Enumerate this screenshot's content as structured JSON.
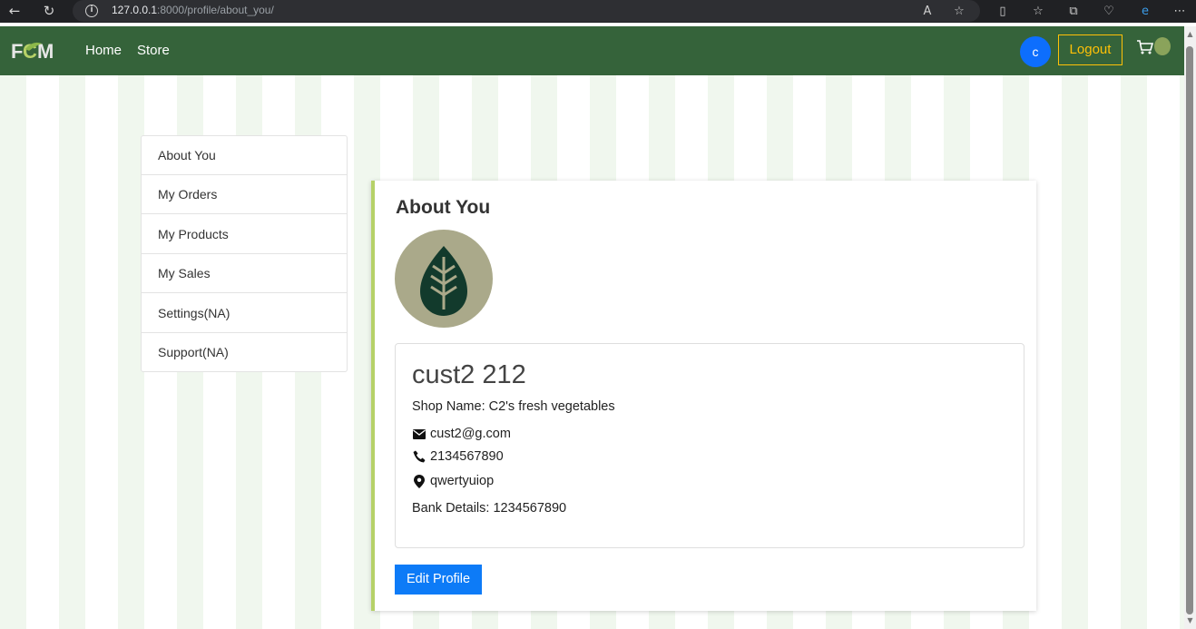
{
  "browser": {
    "url_host": "127.0.0.1",
    "url_path": ":8000/profile/about_you/"
  },
  "navbar": {
    "links": [
      "Home",
      "Store"
    ],
    "avatar_letter": "c",
    "logout_label": "Logout"
  },
  "sidebar": {
    "items": [
      {
        "label": "About You"
      },
      {
        "label": "My Orders"
      },
      {
        "label": "My Products"
      },
      {
        "label": "My Sales"
      },
      {
        "label": "Settings(NA)"
      },
      {
        "label": "Support(NA)"
      }
    ]
  },
  "profile": {
    "heading": "About You",
    "name": "cust2 212",
    "shop_name": "Shop Name: C2's fresh vegetables",
    "email": "cust2@g.com",
    "phone": "2134567890",
    "location": "qwertyuiop",
    "bank": "Bank Details: 1234567890",
    "edit_label": "Edit Profile"
  },
  "colors": {
    "navbar": "#35633a",
    "accent": "#b6d168",
    "logout": "#ffc107",
    "primary": "#0d7bf7"
  }
}
